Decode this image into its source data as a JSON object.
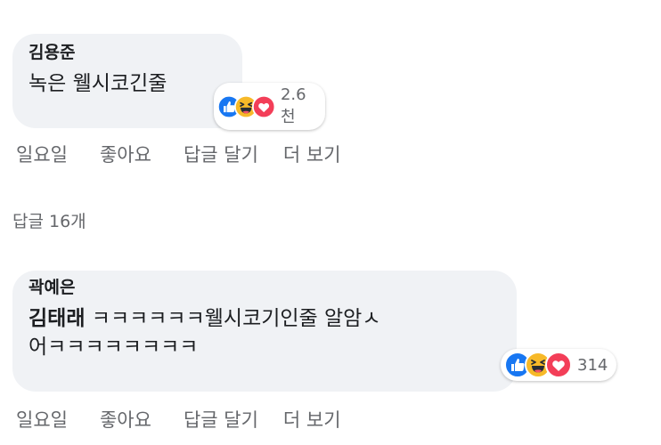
{
  "comment1": {
    "author": "김용준",
    "text": "녹은 웰시코긴줄",
    "reaction_count": "2.6천",
    "actions": {
      "time": "일요일",
      "like": "좋아요",
      "reply": "답글 달기",
      "more": "더 보기"
    }
  },
  "replies_label": "답글 16개",
  "comment2": {
    "author": "곽예은",
    "mention": "김태래",
    "text_line1": " ㅋㅋㅋㅋㅋㅋ웰시코기인줄 알암ㅅ",
    "text_line2": "어ㅋㅋㅋㅋㅋㅋㅋㅋ",
    "reaction_count": "314",
    "actions": {
      "time": "일요일",
      "like": "좋아요",
      "reply": "답글 달기",
      "more": "더 보기"
    }
  },
  "reaction_icons": [
    "like-icon",
    "haha-icon",
    "love-icon"
  ],
  "colors": {
    "bubble": "#f0f2f5",
    "like": "#1877f2",
    "haha": "#f7b928",
    "love": "#f33e58",
    "secondary_text": "#65676b"
  }
}
